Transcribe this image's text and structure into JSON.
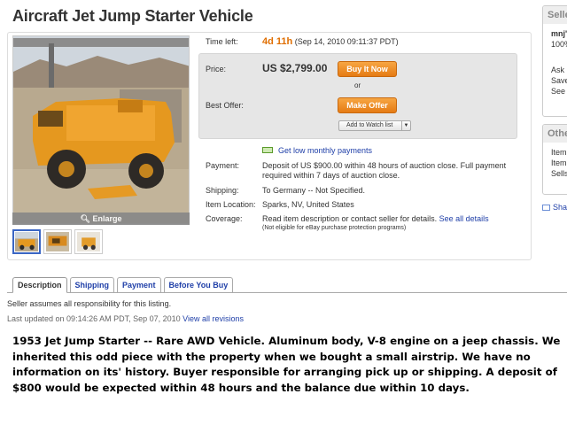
{
  "item": {
    "title": "Aircraft Jet Jump Starter Vehicle"
  },
  "gallery": {
    "enlarge_label": "Enlarge",
    "thumbnails": [
      "thumb-1",
      "thumb-2",
      "thumb-3"
    ]
  },
  "details": {
    "time_left_label": "Time left:",
    "time_left_value": "4d 11h",
    "time_left_end": "(Sep 14, 2010 09:11:37 PDT)",
    "price_label": "Price:",
    "price_value": "US $2,799.00",
    "buy_now_label": "Buy It Now",
    "or_label": "or",
    "best_offer_label": "Best Offer:",
    "make_offer_label": "Make Offer",
    "watch_list_label": "Add to Watch list",
    "low_payments_label": "Get low monthly payments",
    "payment_label": "Payment:",
    "payment_line1": "Deposit of US $900.00 within 48 hours of auction close. Full payment",
    "payment_line2": "required within 7 days of auction close.",
    "shipping_label": "Shipping:",
    "shipping_value": "To Germany -- Not Specified.",
    "location_label": "Item Location:",
    "location_value": "Sparks, NV, United States",
    "coverage_label": "Coverage:",
    "coverage_value": "Read item description or contact seller for details.",
    "coverage_link": "See all details",
    "coverage_note": "(Not eligible for eBay purchase protection programs)"
  },
  "tabs": [
    {
      "label": "Description",
      "active": true
    },
    {
      "label": "Shipping",
      "active": false
    },
    {
      "label": "Payment",
      "active": false
    },
    {
      "label": "Before You Buy",
      "active": false
    }
  ],
  "description": {
    "assumes": "Seller assumes all responsibility for this listing.",
    "updated": "Last updated on 09:14:26 AM PDT, Sep 07, 2010",
    "revisions_link": "View all revisions",
    "lines": [
      "1953 Jet Jump Starter -- Rare AWD Vehicle. Aluminum body, V-8 engine on a jeep chassis. We",
      "inherited this odd piece with the property when we bought a small airstrip. We have no",
      "information on its' history. Buyer responsible for arranging pick up or shipping. A deposit of",
      "$800 would be expected within 48 hours and the balance due within 10 days."
    ]
  },
  "sidebar": {
    "seller_head": "Selle",
    "seller_name": "mnj'",
    "seller_pct": "100%",
    "ask": "Ask",
    "save": "Save",
    "see": "See",
    "other_head": "Othe",
    "other_items": [
      "Item",
      "Item",
      "Sells"
    ],
    "share": "Sha"
  },
  "colors": {
    "accent_orange": "#e57b14",
    "link_blue": "#1f3fa8",
    "time_orange": "#e06e00"
  }
}
